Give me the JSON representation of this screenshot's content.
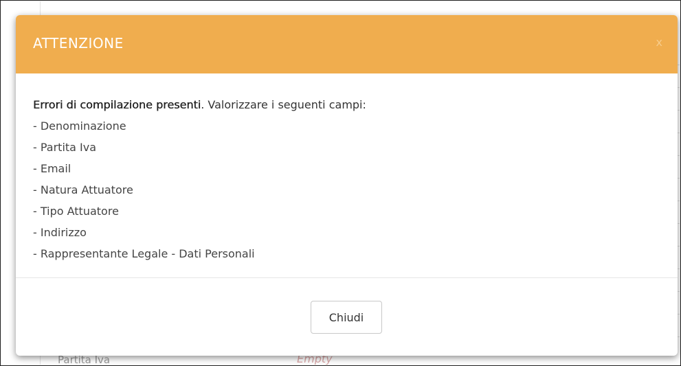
{
  "background": {
    "field_label": "Partita Iva",
    "field_value": "Empty"
  },
  "modal": {
    "title": "ATTENZIONE",
    "close_symbol": "x",
    "header_color": "#f0ad4e",
    "message_bold": "Errori di compilazione presenti",
    "message_rest": ". Valorizzare i seguenti campi:",
    "fields": [
      "- Denominazione",
      "- Partita Iva",
      "- Email",
      "- Natura Attuatore",
      "- Tipo Attuatore",
      "- Indirizzo",
      "- Rappresentante Legale - Dati Personali"
    ],
    "button_label": "Chiudi"
  }
}
